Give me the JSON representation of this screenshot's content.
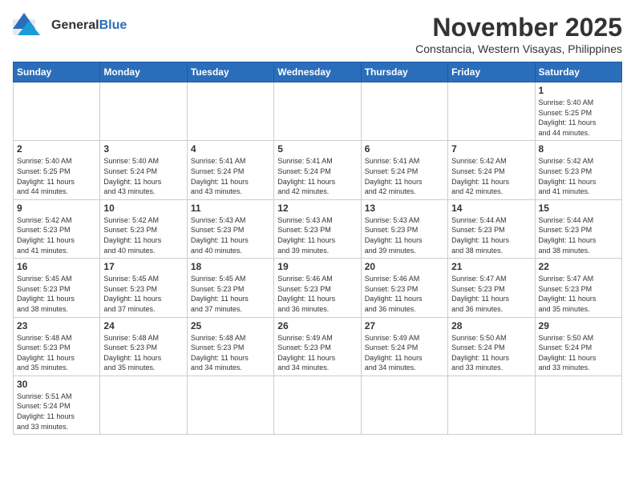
{
  "header": {
    "logo_general": "General",
    "logo_blue": "Blue",
    "month_title": "November 2025",
    "subtitle": "Constancia, Western Visayas, Philippines"
  },
  "days_of_week": [
    "Sunday",
    "Monday",
    "Tuesday",
    "Wednesday",
    "Thursday",
    "Friday",
    "Saturday"
  ],
  "weeks": [
    [
      {
        "day": "",
        "info": ""
      },
      {
        "day": "",
        "info": ""
      },
      {
        "day": "",
        "info": ""
      },
      {
        "day": "",
        "info": ""
      },
      {
        "day": "",
        "info": ""
      },
      {
        "day": "",
        "info": ""
      },
      {
        "day": "1",
        "info": "Sunrise: 5:40 AM\nSunset: 5:25 PM\nDaylight: 11 hours\nand 44 minutes."
      }
    ],
    [
      {
        "day": "2",
        "info": "Sunrise: 5:40 AM\nSunset: 5:25 PM\nDaylight: 11 hours\nand 44 minutes."
      },
      {
        "day": "3",
        "info": "Sunrise: 5:40 AM\nSunset: 5:24 PM\nDaylight: 11 hours\nand 43 minutes."
      },
      {
        "day": "4",
        "info": "Sunrise: 5:41 AM\nSunset: 5:24 PM\nDaylight: 11 hours\nand 43 minutes."
      },
      {
        "day": "5",
        "info": "Sunrise: 5:41 AM\nSunset: 5:24 PM\nDaylight: 11 hours\nand 42 minutes."
      },
      {
        "day": "6",
        "info": "Sunrise: 5:41 AM\nSunset: 5:24 PM\nDaylight: 11 hours\nand 42 minutes."
      },
      {
        "day": "7",
        "info": "Sunrise: 5:42 AM\nSunset: 5:24 PM\nDaylight: 11 hours\nand 42 minutes."
      },
      {
        "day": "8",
        "info": "Sunrise: 5:42 AM\nSunset: 5:23 PM\nDaylight: 11 hours\nand 41 minutes."
      }
    ],
    [
      {
        "day": "9",
        "info": "Sunrise: 5:42 AM\nSunset: 5:23 PM\nDaylight: 11 hours\nand 41 minutes."
      },
      {
        "day": "10",
        "info": "Sunrise: 5:42 AM\nSunset: 5:23 PM\nDaylight: 11 hours\nand 40 minutes."
      },
      {
        "day": "11",
        "info": "Sunrise: 5:43 AM\nSunset: 5:23 PM\nDaylight: 11 hours\nand 40 minutes."
      },
      {
        "day": "12",
        "info": "Sunrise: 5:43 AM\nSunset: 5:23 PM\nDaylight: 11 hours\nand 39 minutes."
      },
      {
        "day": "13",
        "info": "Sunrise: 5:43 AM\nSunset: 5:23 PM\nDaylight: 11 hours\nand 39 minutes."
      },
      {
        "day": "14",
        "info": "Sunrise: 5:44 AM\nSunset: 5:23 PM\nDaylight: 11 hours\nand 38 minutes."
      },
      {
        "day": "15",
        "info": "Sunrise: 5:44 AM\nSunset: 5:23 PM\nDaylight: 11 hours\nand 38 minutes."
      }
    ],
    [
      {
        "day": "16",
        "info": "Sunrise: 5:45 AM\nSunset: 5:23 PM\nDaylight: 11 hours\nand 38 minutes."
      },
      {
        "day": "17",
        "info": "Sunrise: 5:45 AM\nSunset: 5:23 PM\nDaylight: 11 hours\nand 37 minutes."
      },
      {
        "day": "18",
        "info": "Sunrise: 5:45 AM\nSunset: 5:23 PM\nDaylight: 11 hours\nand 37 minutes."
      },
      {
        "day": "19",
        "info": "Sunrise: 5:46 AM\nSunset: 5:23 PM\nDaylight: 11 hours\nand 36 minutes."
      },
      {
        "day": "20",
        "info": "Sunrise: 5:46 AM\nSunset: 5:23 PM\nDaylight: 11 hours\nand 36 minutes."
      },
      {
        "day": "21",
        "info": "Sunrise: 5:47 AM\nSunset: 5:23 PM\nDaylight: 11 hours\nand 36 minutes."
      },
      {
        "day": "22",
        "info": "Sunrise: 5:47 AM\nSunset: 5:23 PM\nDaylight: 11 hours\nand 35 minutes."
      }
    ],
    [
      {
        "day": "23",
        "info": "Sunrise: 5:48 AM\nSunset: 5:23 PM\nDaylight: 11 hours\nand 35 minutes."
      },
      {
        "day": "24",
        "info": "Sunrise: 5:48 AM\nSunset: 5:23 PM\nDaylight: 11 hours\nand 35 minutes."
      },
      {
        "day": "25",
        "info": "Sunrise: 5:48 AM\nSunset: 5:23 PM\nDaylight: 11 hours\nand 34 minutes."
      },
      {
        "day": "26",
        "info": "Sunrise: 5:49 AM\nSunset: 5:23 PM\nDaylight: 11 hours\nand 34 minutes."
      },
      {
        "day": "27",
        "info": "Sunrise: 5:49 AM\nSunset: 5:24 PM\nDaylight: 11 hours\nand 34 minutes."
      },
      {
        "day": "28",
        "info": "Sunrise: 5:50 AM\nSunset: 5:24 PM\nDaylight: 11 hours\nand 33 minutes."
      },
      {
        "day": "29",
        "info": "Sunrise: 5:50 AM\nSunset: 5:24 PM\nDaylight: 11 hours\nand 33 minutes."
      }
    ],
    [
      {
        "day": "30",
        "info": "Sunrise: 5:51 AM\nSunset: 5:24 PM\nDaylight: 11 hours\nand 33 minutes."
      },
      {
        "day": "",
        "info": ""
      },
      {
        "day": "",
        "info": ""
      },
      {
        "day": "",
        "info": ""
      },
      {
        "day": "",
        "info": ""
      },
      {
        "day": "",
        "info": ""
      },
      {
        "day": "",
        "info": ""
      }
    ]
  ]
}
